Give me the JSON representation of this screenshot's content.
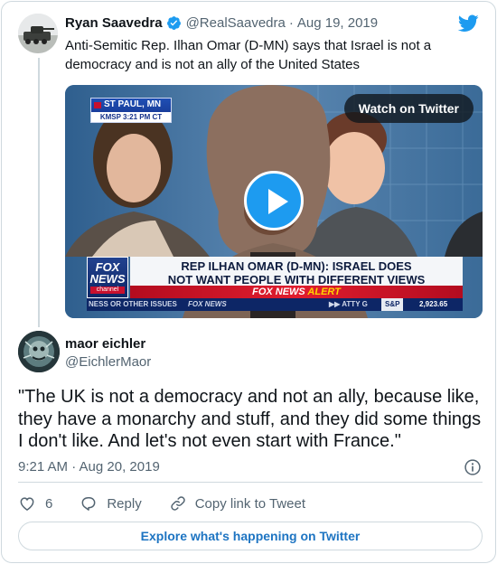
{
  "quoted_tweet": {
    "author_name": "Ryan Saavedra",
    "handle": "@RealSaavedra",
    "separator": "·",
    "date": "Aug 19, 2019",
    "text": "Anti-Semitic Rep. Ilhan Omar (D-MN) says that Israel is not a democracy and is not an ally of the United States",
    "video": {
      "watch_label": "Watch on Twitter",
      "broadcast": {
        "location": "ST PAUL, MN",
        "station_time": "KMSP  3:21 PM CT",
        "network_logo_line1": "FOX",
        "network_logo_line2": "NEWS",
        "network_logo_line3": "channel",
        "headline_line1": "REP ILHAN OMAR (D-MN): ISRAEL DOES",
        "headline_line2": "NOT WANT PEOPLE WITH DIFFERENT VIEWS",
        "alert_prefix": "FOX NEWS",
        "alert_word": "ALERT",
        "ticker_left": "NESS OR OTHER ISSUES",
        "ticker_brand": "FOX NEWS",
        "ticker_mid": "▶▶  ATTY G",
        "ticker_index": "S&P",
        "ticker_value": "2,923.65"
      }
    }
  },
  "main_tweet": {
    "author_name": "maor eichler",
    "handle": "@EichlerMaor",
    "text": "\"The UK is not a democracy and not an ally, because like, they have a monarchy and stuff, and they did some things I don't like. And let's not even start with France.\"",
    "timestamp": "9:21 AM · Aug 20, 2019"
  },
  "actions": {
    "like_count": "6",
    "reply_label": "Reply",
    "copy_link_label": "Copy link to Tweet"
  },
  "explore_label": "Explore what's happening on Twitter",
  "colors": {
    "twitter_blue": "#1d9bf0",
    "text_primary": "#0f1419",
    "text_secondary": "#536471",
    "border": "#cfd9de",
    "explore_text": "#1d74c2"
  },
  "icons": [
    "verified-badge-icon",
    "twitter-bird-icon",
    "play-icon",
    "info-icon",
    "heart-icon",
    "reply-icon",
    "link-icon"
  ]
}
